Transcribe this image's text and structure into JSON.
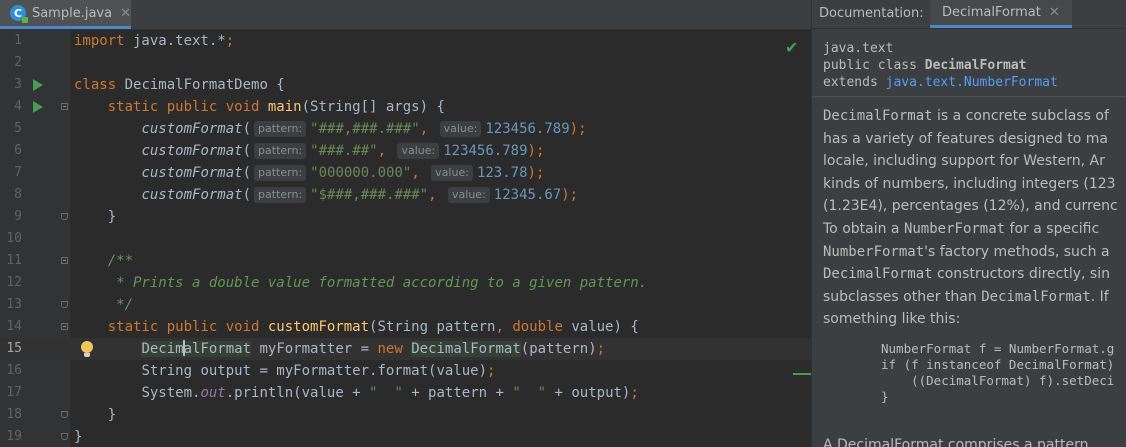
{
  "editor": {
    "tab": {
      "label": "Sample.java",
      "icon": "java-class-icon",
      "close": "✕"
    },
    "line_numbers": [
      "1",
      "2",
      "3",
      "4",
      "5",
      "6",
      "7",
      "8",
      "9",
      "10",
      "11",
      "12",
      "13",
      "14",
      "15",
      "16",
      "17",
      "18",
      "19"
    ],
    "current_line": 15,
    "lines": {
      "l1": [
        "import",
        " java.text.*",
        ";"
      ],
      "l3": [
        "class",
        " DecimalFormatDemo {"
      ],
      "l4": [
        "static public void",
        "main",
        "(String[] args) {"
      ],
      "l5": [
        "customFormat",
        "(",
        "pattern:",
        "\"###,###.###\"",
        ", ",
        "value:",
        "123456.789",
        ");"
      ],
      "l6": [
        "customFormat",
        "(",
        "pattern:",
        "\"###.##\"",
        ", ",
        "value:",
        "123456.789",
        ");"
      ],
      "l7": [
        "customFormat",
        "(",
        "pattern:",
        "\"000000.000\"",
        ", ",
        "value:",
        "123.78",
        ");"
      ],
      "l8": [
        "customFormat",
        "(",
        "pattern:",
        "\"$###,###.###\"",
        ", ",
        "value:",
        "12345.67",
        ");"
      ],
      "l9": [
        "}"
      ],
      "l11": [
        "/**"
      ],
      "l12": [
        " * Prints a double value formatted according to a given pattern."
      ],
      "l13": [
        " */"
      ],
      "l14": [
        "static public void",
        "customFormat",
        "(String pattern",
        ", ",
        "double",
        " value) {"
      ],
      "l15": [
        "Decim",
        "alFormat",
        " myFormatter = ",
        "new",
        " ",
        "DecimalFormat",
        "(pattern)",
        ";"
      ],
      "l16": [
        "String output = myFormatter.format(value)",
        ";"
      ],
      "l17": [
        "System.",
        "out",
        ".println(value + ",
        "\"  \"",
        " + pattern + ",
        "\"  \"",
        " + output)",
        ";"
      ],
      "l18": [
        "}"
      ],
      "l19": [
        "}"
      ]
    }
  },
  "doc": {
    "label": "Documentation:",
    "tab": {
      "label": "DecimalFormat",
      "close": "✕"
    },
    "package": "java.text",
    "decl_prefix": "public class ",
    "decl_name": "DecimalFormat",
    "extends_prefix": "extends ",
    "extends_link": "java.text.NumberFormat",
    "body": [
      [
        "DecimalFormat",
        " is a concrete subclass of"
      ],
      [
        "has a variety of features designed to ma"
      ],
      [
        "locale, including support for Western, Ar"
      ],
      [
        "kinds of numbers, including integers (123"
      ],
      [
        "(1.23E4), percentages (12%), and currenc"
      ],
      [
        "To obtain a ",
        "NumberFormat",
        " for a specific"
      ],
      [
        "NumberFormat",
        "'s factory methods, such a"
      ],
      [
        "DecimalFormat",
        " constructors directly, sin"
      ],
      [
        "subclasses other than ",
        "DecimalFormat",
        ". If"
      ],
      [
        "something like this:"
      ]
    ],
    "code": [
      "NumberFormat f = NumberFormat.g",
      "if (f instanceof DecimalFormat)",
      "    ((DecimalFormat) f).setDeci",
      "}"
    ],
    "more": "A DecimalFormat comprises a pattern"
  },
  "colors": {
    "background": "#2b2b2b",
    "keyword": "#cc7832",
    "string": "#6a8759",
    "number": "#6897bb",
    "accent": "#4a88c7"
  }
}
